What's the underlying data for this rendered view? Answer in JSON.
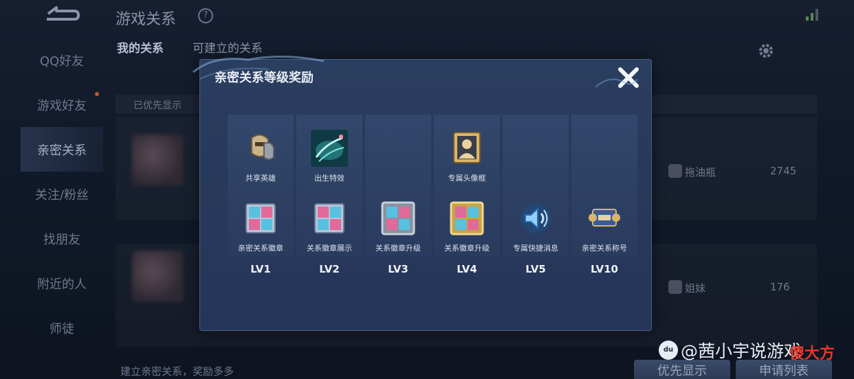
{
  "header": {
    "title": "游戏关系",
    "help_glyph": "?"
  },
  "sidebar": {
    "items": [
      {
        "label": "QQ好友"
      },
      {
        "label": "游戏好友"
      },
      {
        "label": "亲密关系"
      },
      {
        "label": "关注/粉丝"
      },
      {
        "label": "找朋友"
      },
      {
        "label": "附近的人"
      },
      {
        "label": "师徒"
      }
    ]
  },
  "tabs": [
    {
      "label": "我的关系"
    },
    {
      "label": "可建立的关系"
    }
  ],
  "list": {
    "pinned_label": "已优先显示",
    "entries": [
      {
        "relation": "拖油瓶",
        "count": "2745"
      },
      {
        "relation": "姐妹",
        "count": "176"
      }
    ]
  },
  "footer": {
    "tip": "建立亲密关系，奖励多多",
    "priority_button": "优先显示",
    "apply_button": "申请列表"
  },
  "dialog": {
    "title": "亲密关系等级奖励",
    "close_glyph": "✕",
    "rewards_row1": [
      {
        "label": "共享英雄",
        "icon": "shared-hero-icon"
      },
      {
        "label": "出生特效",
        "icon": "spawn-effect-icon"
      },
      {
        "label": "",
        "icon": ""
      },
      {
        "label": "专属头像框",
        "icon": "avatar-frame-icon"
      },
      {
        "label": "",
        "icon": ""
      },
      {
        "label": "",
        "icon": ""
      }
    ],
    "rewards_row2": [
      {
        "label": "亲密关系徽章",
        "icon": "badge-icon"
      },
      {
        "label": "关系徽章展示",
        "icon": "badge-display-icon"
      },
      {
        "label": "关系徽章升级",
        "icon": "badge-upgrade-icon"
      },
      {
        "label": "关系徽章升级",
        "icon": "badge-upgrade-gold-icon"
      },
      {
        "label": "专属快捷消息",
        "icon": "speaker-icon"
      },
      {
        "label": "亲密关系称号",
        "icon": "title-scroll-icon"
      }
    ],
    "levels": [
      "LV1",
      "LV2",
      "LV3",
      "LV4",
      "LV5",
      "LV10"
    ]
  },
  "watermark": {
    "logo": "du",
    "text": "@茜小宇说游戏",
    "badge": "傻大方"
  },
  "colors": {
    "dialog_bg": "#2a3e5f",
    "accent_text": "#e8eef7",
    "badge_red": "#e23a2c"
  }
}
